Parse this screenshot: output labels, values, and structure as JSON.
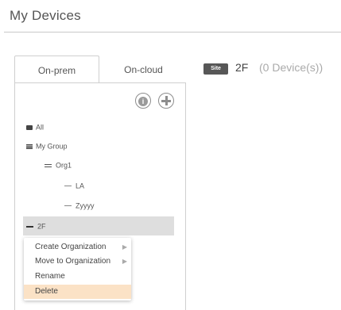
{
  "header": {
    "title": "My Devices"
  },
  "tabs": [
    {
      "label": "On-prem",
      "active": true
    },
    {
      "label": "On-cloud",
      "active": false
    }
  ],
  "toolbar": {
    "info_icon": "info-icon",
    "add_icon": "add-icon",
    "info_glyph": "i"
  },
  "tree": {
    "all": "All",
    "group": "My Group",
    "org": "Org1",
    "site_la": "LA",
    "site_zyyyy": "Zyyyy",
    "site_2f": "2F"
  },
  "context_menu": {
    "items": [
      {
        "label": "Create Organization",
        "submenu": true
      },
      {
        "label": "Move to Organization",
        "submenu": true
      },
      {
        "label": "Rename",
        "submenu": false
      },
      {
        "label": "Delete",
        "submenu": false,
        "highlighted": true
      }
    ]
  },
  "site_header": {
    "badge": "Site",
    "name": "2F",
    "device_count": "(0 Device(s))"
  },
  "colors": {
    "highlight": "#fbe2c6",
    "selected_row": "#dedede",
    "badge_bg": "#575757"
  }
}
